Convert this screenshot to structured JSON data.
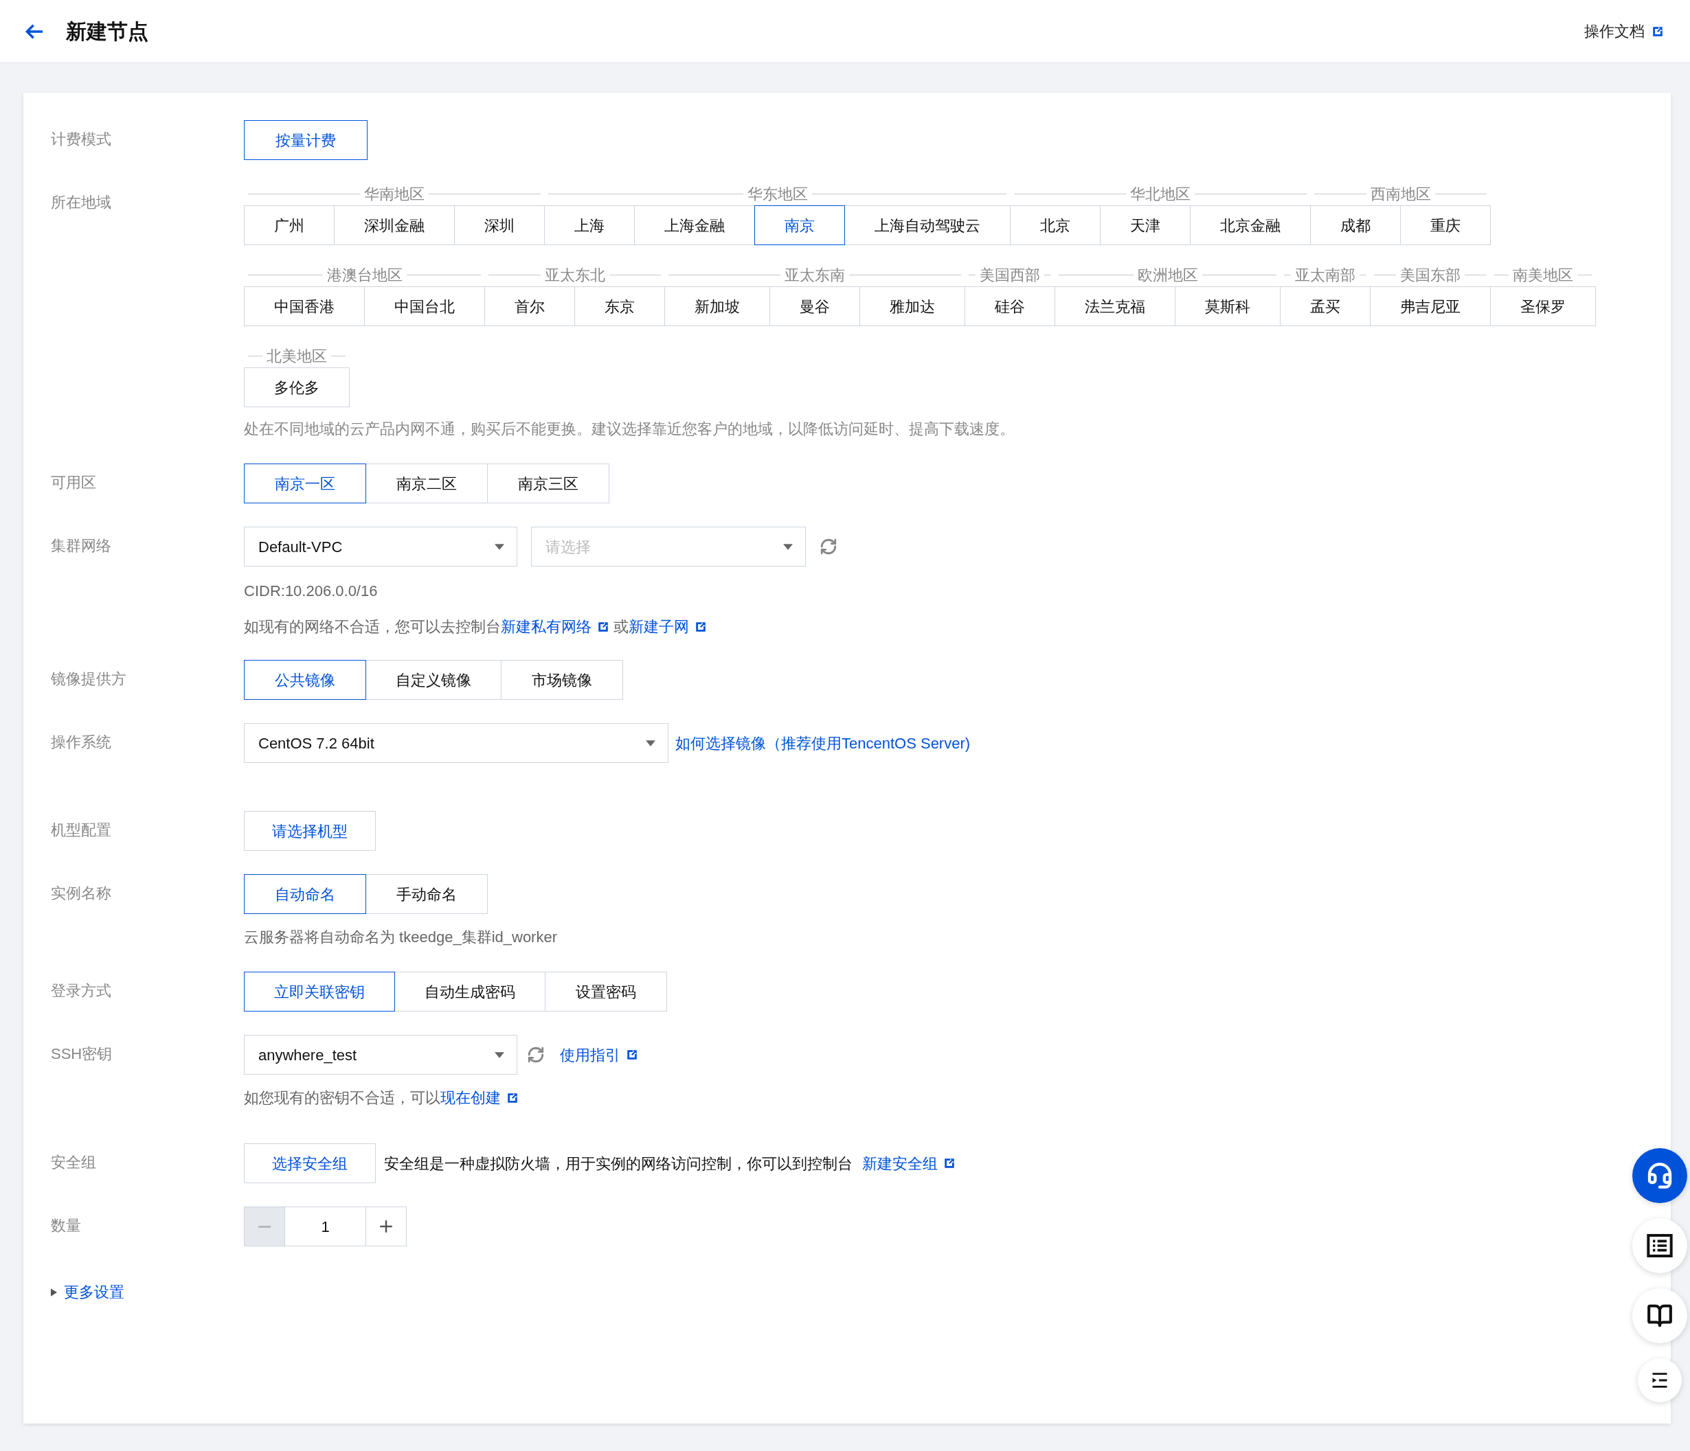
{
  "header": {
    "title": "新建节点",
    "doc_link": "操作文档"
  },
  "billing": {
    "label": "计费模式",
    "options": [
      {
        "label": "按量计费",
        "selected": true
      }
    ]
  },
  "region": {
    "label": "所在地域",
    "groups": [
      {
        "name": "华南地区",
        "options": [
          {
            "label": "广州",
            "selected": false
          },
          {
            "label": "深圳金融",
            "selected": false
          },
          {
            "label": "深圳",
            "selected": false
          }
        ]
      },
      {
        "name": "华东地区",
        "options": [
          {
            "label": "上海",
            "selected": false
          },
          {
            "label": "上海金融",
            "selected": false
          },
          {
            "label": "南京",
            "selected": true
          },
          {
            "label": "上海自动驾驶云",
            "selected": false
          }
        ]
      },
      {
        "name": "华北地区",
        "options": [
          {
            "label": "北京",
            "selected": false
          },
          {
            "label": "天津",
            "selected": false
          },
          {
            "label": "北京金融",
            "selected": false
          }
        ]
      },
      {
        "name": "西南地区",
        "options": [
          {
            "label": "成都",
            "selected": false
          },
          {
            "label": "重庆",
            "selected": false
          }
        ]
      },
      {
        "name": "港澳台地区",
        "options": [
          {
            "label": "中国香港",
            "selected": false
          },
          {
            "label": "中国台北",
            "selected": false
          }
        ]
      },
      {
        "name": "亚太东北",
        "options": [
          {
            "label": "首尔",
            "selected": false
          },
          {
            "label": "东京",
            "selected": false
          }
        ]
      },
      {
        "name": "亚太东南",
        "options": [
          {
            "label": "新加坡",
            "selected": false
          },
          {
            "label": "曼谷",
            "selected": false
          },
          {
            "label": "雅加达",
            "selected": false
          }
        ]
      },
      {
        "name": "美国西部",
        "options": [
          {
            "label": "硅谷",
            "selected": false
          }
        ]
      },
      {
        "name": "欧洲地区",
        "options": [
          {
            "label": "法兰克福",
            "selected": false
          },
          {
            "label": "莫斯科",
            "selected": false
          }
        ]
      },
      {
        "name": "亚太南部",
        "options": [
          {
            "label": "孟买",
            "selected": false
          }
        ]
      },
      {
        "name": "美国东部",
        "options": [
          {
            "label": "弗吉尼亚",
            "selected": false
          }
        ]
      },
      {
        "name": "南美地区",
        "options": [
          {
            "label": "圣保罗",
            "selected": false
          }
        ]
      },
      {
        "name": "北美地区",
        "options": [
          {
            "label": "多伦多",
            "selected": false
          }
        ]
      }
    ],
    "hint": "处在不同地域的云产品内网不通，购买后不能更换。建议选择靠近您客户的地域，以降低访问延时、提高下载速度。"
  },
  "zone": {
    "label": "可用区",
    "options": [
      {
        "label": "南京一区",
        "selected": true
      },
      {
        "label": "南京二区",
        "selected": false
      },
      {
        "label": "南京三区",
        "selected": false
      }
    ]
  },
  "network": {
    "label": "集群网络",
    "vpc_value": "Default-VPC",
    "subnet_placeholder": "请选择",
    "cidr": "CIDR:10.206.0.0/16",
    "hint_text": "如现有的网络不合适，您可以去控制台",
    "link_vpc": "新建私有网络",
    "separator": "或",
    "link_subnet": "新建子网"
  },
  "image_provider": {
    "label": "镜像提供方",
    "options": [
      {
        "label": "公共镜像",
        "selected": true
      },
      {
        "label": "自定义镜像",
        "selected": false
      },
      {
        "label": "市场镜像",
        "selected": false
      }
    ]
  },
  "os": {
    "label": "操作系统",
    "value": "CentOS 7.2 64bit",
    "link": "如何选择镜像（推荐使用TencentOS Server)"
  },
  "machine": {
    "label": "机型配置",
    "button": "请选择机型"
  },
  "instance_name": {
    "label": "实例名称",
    "options": [
      {
        "label": "自动命名",
        "selected": true
      },
      {
        "label": "手动命名",
        "selected": false
      }
    ],
    "hint": "云服务器将自动命名为 tkeedge_集群id_worker"
  },
  "login": {
    "label": "登录方式",
    "options": [
      {
        "label": "立即关联密钥",
        "selected": true
      },
      {
        "label": "自动生成密码",
        "selected": false
      },
      {
        "label": "设置密码",
        "selected": false
      }
    ]
  },
  "ssh": {
    "label": "SSH密钥",
    "value": "anywhere_test",
    "guide_link": "使用指引",
    "hint_text": "如您现有的密钥不合适，可以",
    "create_link": "现在创建"
  },
  "security": {
    "label": "安全组",
    "button": "选择安全组",
    "text": "安全组是一种虚拟防火墙，用于实例的网络访问控制，你可以到控制台",
    "link": "新建安全组"
  },
  "quantity": {
    "label": "数量",
    "value": "1",
    "minus_disabled": true
  },
  "more_settings": {
    "label": "更多设置",
    "expanded": false
  }
}
